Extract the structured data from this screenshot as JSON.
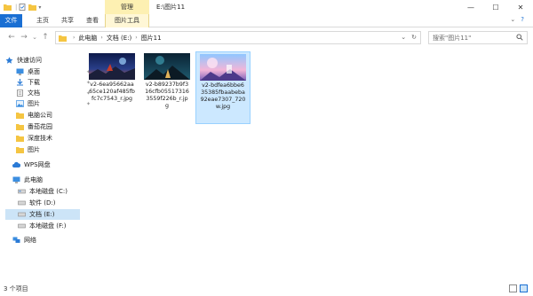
{
  "window": {
    "context_label": "管理",
    "title": "E:\\图片11",
    "minimize": "—",
    "maximize": "☐",
    "close": "✕"
  },
  "ribbon": {
    "tabs": [
      "文件",
      "主页",
      "共享",
      "查看",
      "图片工具"
    ],
    "right_icons": [
      "chevron-icon",
      "help-icon"
    ]
  },
  "address_bar": {
    "back": "←",
    "forward": "→",
    "up_menu": "⌄",
    "up": "↑",
    "crumbs": [
      "此电脑",
      "文档 (E:)",
      "图片11"
    ],
    "search_placeholder": "搜索\"图片11\""
  },
  "nav": {
    "quick_access": "快速访问",
    "items": [
      {
        "label": "桌面",
        "icon": "desktop-icon",
        "pinned": true
      },
      {
        "label": "下载",
        "icon": "download-icon",
        "pinned": true
      },
      {
        "label": "文档",
        "icon": "document-icon",
        "pinned": true
      },
      {
        "label": "图片",
        "icon": "pictures-icon",
        "pinned": true
      },
      {
        "label": "电脑公司",
        "icon": "folder-icon",
        "pinned": false
      },
      {
        "label": "番茄花园",
        "icon": "folder-icon",
        "pinned": false
      },
      {
        "label": "深度技术",
        "icon": "folder-icon",
        "pinned": false
      },
      {
        "label": "图片",
        "icon": "folder-icon",
        "pinned": false
      }
    ],
    "wps": "WPS网盘",
    "this_pc": "此电脑",
    "drives": [
      {
        "label": "本地磁盘 (C:)",
        "selected": false
      },
      {
        "label": "软件 (D:)",
        "selected": false
      },
      {
        "label": "文档 (E:)",
        "selected": true
      },
      {
        "label": "本地磁盘 (F:)",
        "selected": false
      }
    ],
    "network": "网络"
  },
  "files": [
    {
      "name_lines": [
        "v2-6ea95662aa",
        "65ce120af485fb",
        "fc7c7543_r.jpg"
      ],
      "selected": false
    },
    {
      "name_lines": [
        "v2-b89237b9f3",
        "16cfb05517316",
        "3559f226b_r.jp",
        "g"
      ],
      "selected": false
    },
    {
      "name_lines": [
        "v2-bdfea6bbe6",
        "35385fbaabeba",
        "92eae7307_720",
        "w.jpg"
      ],
      "selected": true
    }
  ],
  "status": {
    "text": "3 个项目"
  },
  "colors": {
    "accent": "#1a6fd3",
    "selection": "#cce4f7",
    "context_tab": "#fdf0b2",
    "folder": "#f5c542"
  }
}
